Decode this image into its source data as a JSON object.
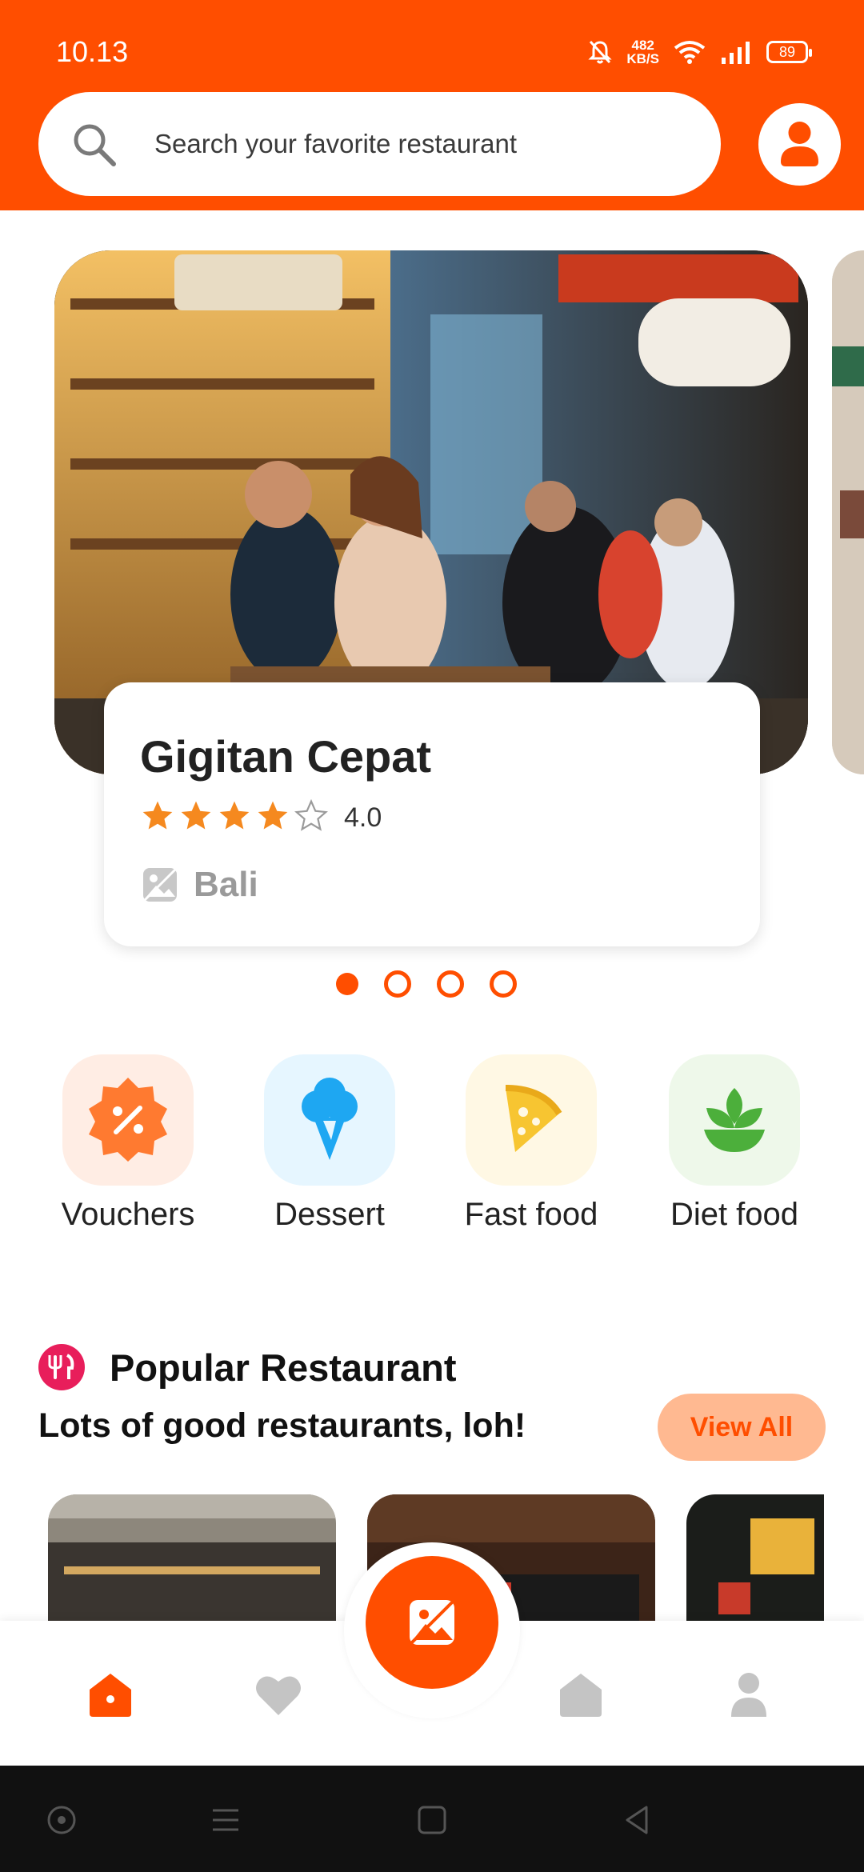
{
  "status_bar": {
    "time": "10.13",
    "net_speed_value": "482",
    "net_speed_unit": "KB/S",
    "battery": "89"
  },
  "search": {
    "placeholder": "Search your favorite restaurant"
  },
  "featured": {
    "name": "Gigitan Cepat",
    "rating": 4.0,
    "rating_text": "4.0",
    "stars_filled": 4,
    "stars_total": 5,
    "location": "Bali"
  },
  "carousel": {
    "page_count": 4,
    "active_index": 0
  },
  "categories": [
    {
      "label": "Vouchers",
      "icon": "voucher-badge-icon",
      "bg": "#FFEDE4",
      "color": "#FF7A30"
    },
    {
      "label": "Dessert",
      "icon": "ice-cream-icon",
      "bg": "#E6F6FF",
      "color": "#1EA7F2"
    },
    {
      "label": "Fast food",
      "icon": "pizza-slice-icon",
      "bg": "#FFF8E4",
      "color": "#F7C531"
    },
    {
      "label": "Diet food",
      "icon": "leaf-plant-icon",
      "bg": "#EEF8EA",
      "color": "#4CAF3B"
    }
  ],
  "popular": {
    "title": "Popular Restaurant",
    "subtitle": "Lots of good restaurants, loh!",
    "view_all": "View All"
  },
  "colors": {
    "accent": "#FF4E00",
    "view_all_bg": "#FFB991",
    "popular_icon_bg": "#E81E5B"
  },
  "bottom_nav": {
    "items": [
      "home-icon",
      "heart-icon",
      "image-fab-icon",
      "house-icon",
      "profile-icon"
    ],
    "active": "home-icon"
  }
}
